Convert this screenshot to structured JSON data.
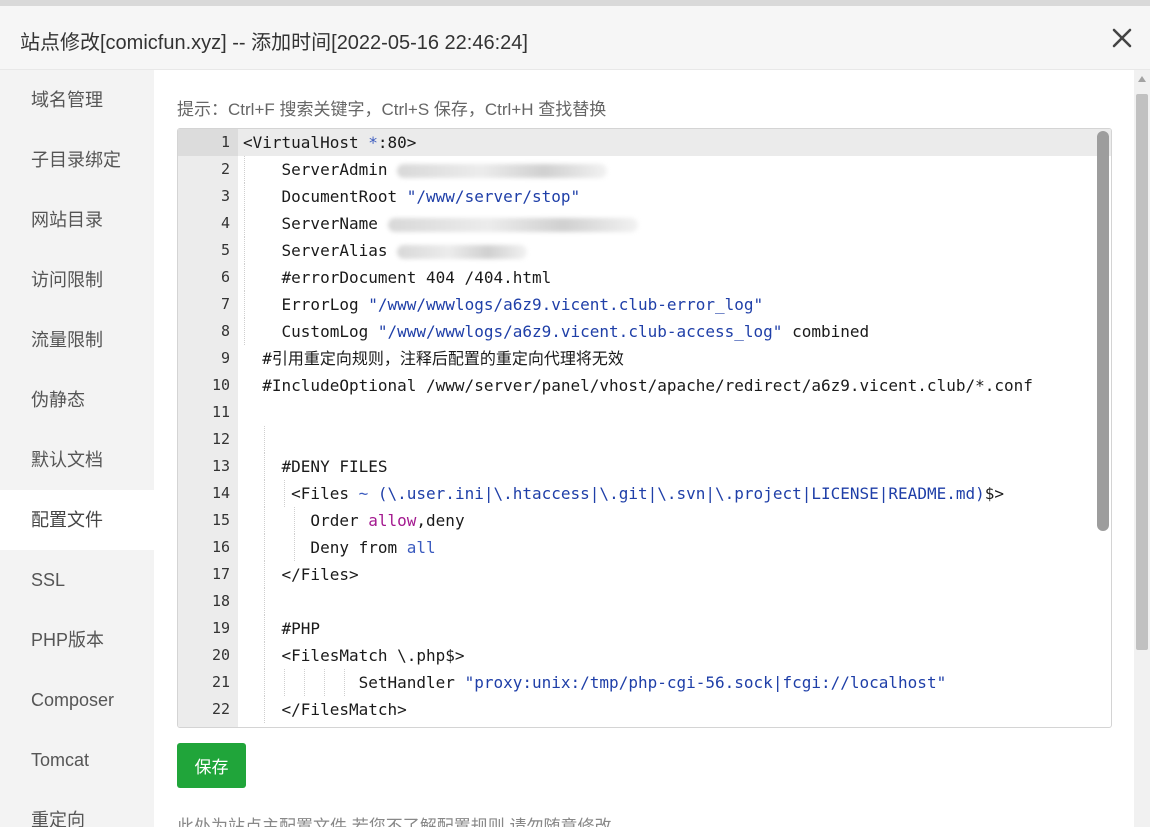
{
  "dialog": {
    "title": "站点修改[comicfun.xyz] -- 添加时间[2022-05-16 22:46:24]"
  },
  "sidebar": {
    "items": [
      {
        "label": "域名管理"
      },
      {
        "label": "子目录绑定"
      },
      {
        "label": "网站目录"
      },
      {
        "label": "访问限制"
      },
      {
        "label": "流量限制"
      },
      {
        "label": "伪静态"
      },
      {
        "label": "默认文档"
      },
      {
        "label": "配置文件",
        "active": true
      },
      {
        "label": "SSL"
      },
      {
        "label": "PHP版本"
      },
      {
        "label": "Composer"
      },
      {
        "label": "Tomcat"
      },
      {
        "label": "重定向"
      }
    ]
  },
  "main": {
    "tip": "提示：Ctrl+F 搜索关键字，Ctrl+S 保存，Ctrl+H 查找替换",
    "save_label": "保存",
    "note": "此处为站点主配置文件,若您不了解配置规则,请勿随意修改."
  },
  "editor": {
    "line_numbers": [
      "1",
      "2",
      "3",
      "4",
      "5",
      "6",
      "7",
      "8",
      "9",
      "10",
      "11",
      "12",
      "13",
      "14",
      "15",
      "16",
      "17",
      "18",
      "19",
      "20",
      "21",
      "22"
    ],
    "lines": [
      "<VirtualHost *:80>",
      "    ServerAdmin ",
      "    DocumentRoot \"/www/server/stop\"",
      "    ServerName ",
      "    ServerAlias ",
      "    #errorDocument 404 /404.html",
      "    ErrorLog \"/www/wwwlogs/a6z9.vicent.club-error_log\"",
      "    CustomLog \"/www/wwwlogs/a6z9.vicent.club-access_log\" combined",
      "  #引用重定向规则，注释后配置的重定向代理将无效",
      "  #IncludeOptional /www/server/panel/vhost/apache/redirect/a6z9.vicent.club/*.conf",
      "",
      "",
      "    #DENY FILES",
      "     <Files ~ (\\.user.ini|\\.htaccess|\\.git|\\.svn|\\.project|LICENSE|README.md)$>",
      "       Order allow,deny",
      "       Deny from all",
      "    </Files>",
      "",
      "    #PHP",
      "    <FilesMatch \\.php$>",
      "            SetHandler \"proxy:unix:/tmp/php-cgi-56.sock|fcgi://localhost\"",
      "    </FilesMatch>"
    ]
  },
  "colors": {
    "accent": "#20a53a",
    "string": "#1f3fa8",
    "comment": "#238a2e",
    "keyword": "#a3198f"
  }
}
